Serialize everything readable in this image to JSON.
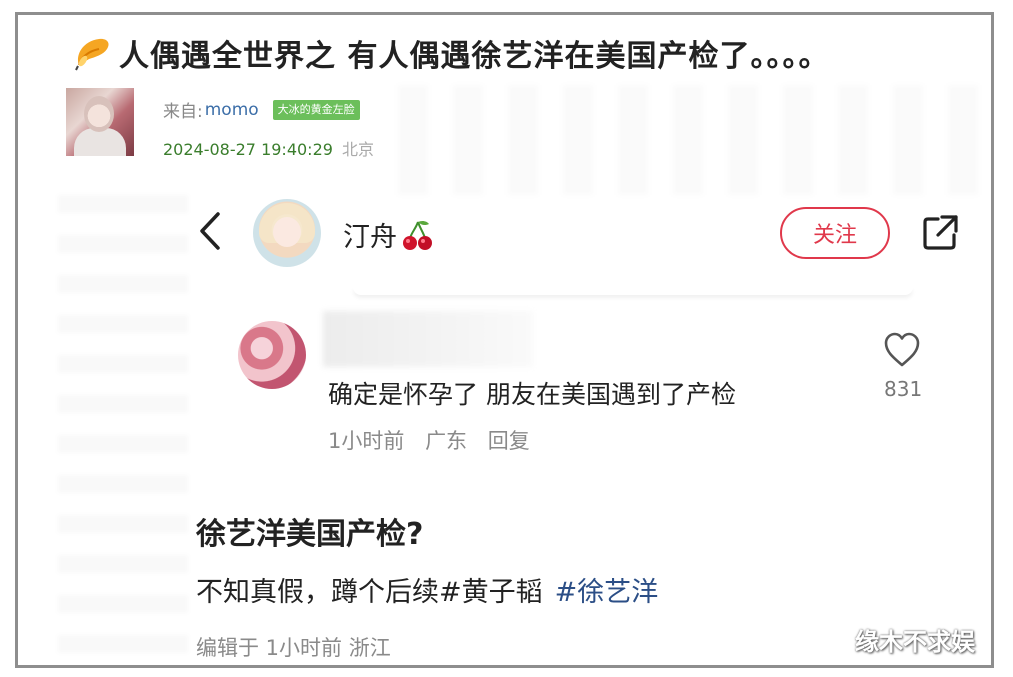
{
  "post": {
    "title": "人偶遇全世界之 有人偶遇徐艺洋在美国产检了。。。。",
    "source_prefix": "来自:",
    "source_user": "momo",
    "badge": "大冰的黄金左脸",
    "datetime": "2024-08-27 19:40:29",
    "location": "北京"
  },
  "screenshot": {
    "user_name": "汀舟",
    "follow_label": "关注",
    "comment": {
      "text": "确定是怀孕了 朋友在美国遇到了产检",
      "time": "1小时前",
      "location": "广东",
      "reply_label": "回复",
      "likes": "831"
    },
    "heading": "徐艺洋美国产检?",
    "body_text": "不知真假，蹲个后续#黄子韬",
    "hashtag": "#徐艺洋",
    "edit_meta": "编辑于 1小时前 浙江"
  },
  "watermark": "缘木不求娱",
  "icons": {
    "title_icon": "butterfly-icon",
    "back": "chevron-left-icon",
    "emoji": "cherry-icon",
    "share": "share-icon",
    "like": "heart-icon"
  },
  "colors": {
    "follow_accent": "#e0384b",
    "source_user": "#3c6ea8",
    "badge_bg": "#6cbf5b",
    "datetime": "#3a7d2c",
    "hashtag": "#2b4e86"
  }
}
